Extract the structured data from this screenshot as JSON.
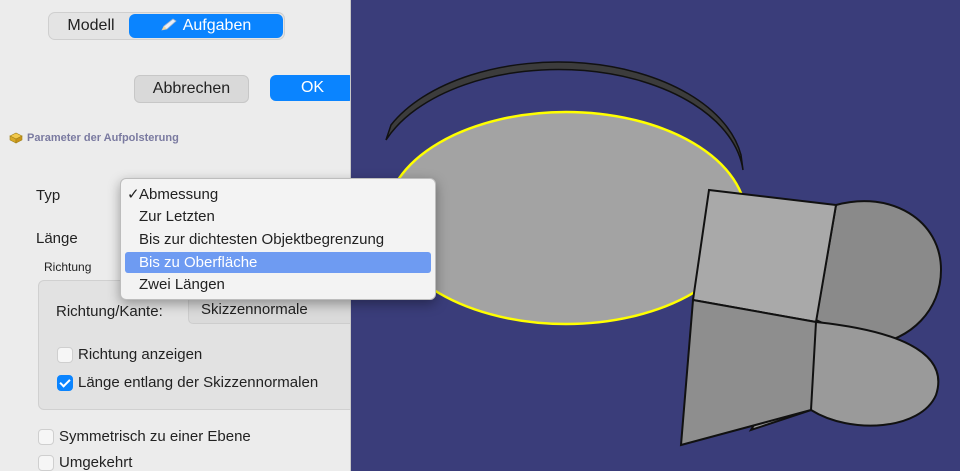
{
  "tabs": {
    "modell": "Modell",
    "aufgaben": "Aufgaben"
  },
  "buttons": {
    "cancel": "Abbrechen",
    "ok": "OK"
  },
  "section": {
    "title": "Parameter der Aufpolsterung"
  },
  "form": {
    "typ_label": "Typ",
    "laenge_label": "Länge",
    "richtung_group": "Richtung",
    "richtung_kante_label": "Richtung/Kante:",
    "richtung_kante_value": "Skizzennormale",
    "richtung_anzeigen": {
      "label": "Richtung anzeigen",
      "checked": false
    },
    "laenge_entlang": {
      "label": "Länge entlang der Skizzennormalen",
      "checked": true
    },
    "symmetrisch": {
      "label": "Symmetrisch zu einer Ebene",
      "checked": false
    },
    "umgekehrt": {
      "label": "Umgekehrt",
      "checked": false
    }
  },
  "dropdown": {
    "items": [
      {
        "label": "Abmessung",
        "selected": true
      },
      {
        "label": "Zur Letzten"
      },
      {
        "label": "Bis zur dichtesten Objektbegrenzung"
      },
      {
        "label": "Bis zu Oberfläche",
        "highlighted": true
      },
      {
        "label": "Zwei Längen"
      }
    ],
    "check_glyph": "✓"
  },
  "colors": {
    "accent": "#0a84ff",
    "viewport_bg": "#3a3d7a",
    "selection_edge": "#ffff00",
    "highlight": "#6e9bf2"
  }
}
